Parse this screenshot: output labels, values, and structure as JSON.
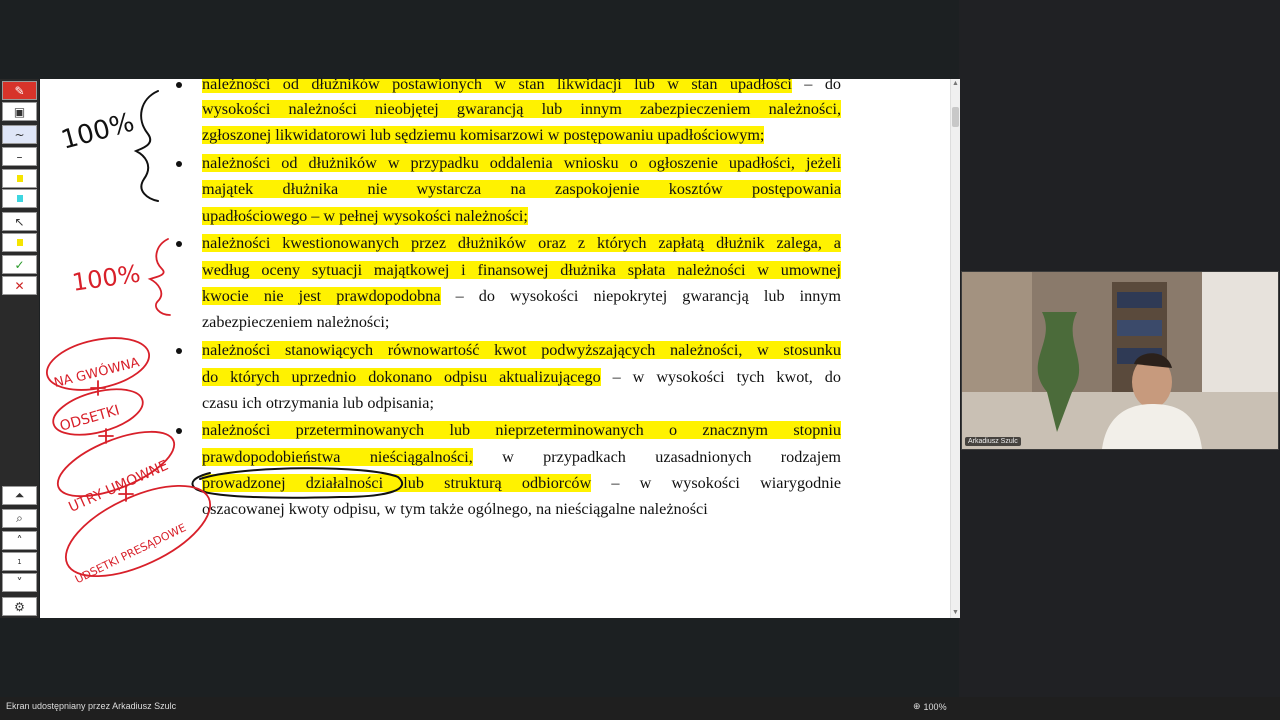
{
  "document": {
    "lines": [
      {
        "segs": [
          {
            "t": "należności od dłużników postawionych w stan likwidacji lub w stan upadłości",
            "h": true
          },
          {
            "t": " – do",
            "h": false
          }
        ],
        "bullet": true,
        "justify": true
      },
      {
        "segs": [
          {
            "t": "wysokości należności nieobjętej gwarancją lub innym zabezpieczeniem należności,",
            "h": true
          }
        ],
        "bullet": false,
        "justify": true
      },
      {
        "segs": [
          {
            "t": "zgłoszonej likwidatorowi lub sędziemu komisarzowi w postępowaniu upadłościowym;",
            "h": true
          }
        ],
        "bullet": false,
        "justify": false
      },
      {
        "segs": [
          {
            "t": "należności od dłużników w przypadku oddalenia wniosku o ogłoszenie upadłości, jeżeli",
            "h": true
          }
        ],
        "bullet": true,
        "justify": true
      },
      {
        "segs": [
          {
            "t": "majątek dłużnika nie wystarcza na zaspokojenie kosztów postępowania",
            "h": true
          }
        ],
        "bullet": false,
        "justify": true
      },
      {
        "segs": [
          {
            "t": "upadłościowego – w pełnej wysokości należności;",
            "h": true
          }
        ],
        "bullet": false,
        "justify": false
      },
      {
        "segs": [
          {
            "t": "należności kwestionowanych przez dłużników oraz z których zapłatą dłużnik zalega, a",
            "h": true
          }
        ],
        "bullet": true,
        "justify": true
      },
      {
        "segs": [
          {
            "t": "według oceny sytuacji majątkowej i finansowej dłużnika spłata należności w umownej",
            "h": true
          }
        ],
        "bullet": false,
        "justify": true
      },
      {
        "segs": [
          {
            "t": "kwocie nie jest prawdopodobna",
            "h": true
          },
          {
            "t": " – do wysokości niepokrytej gwarancją lub innym",
            "h": false
          }
        ],
        "bullet": false,
        "justify": true
      },
      {
        "segs": [
          {
            "t": "zabezpieczeniem należności;",
            "h": false
          }
        ],
        "bullet": false,
        "justify": false
      },
      {
        "segs": [
          {
            "t": "należności stanowiących równowartość kwot podwyższających należności, w stosunku",
            "h": true
          }
        ],
        "bullet": true,
        "justify": true
      },
      {
        "segs": [
          {
            "t": "do których uprzednio dokonano odpisu aktualizującego",
            "h": true
          },
          {
            "t": " – w wysokości tych kwot, do",
            "h": false
          }
        ],
        "bullet": false,
        "justify": true
      },
      {
        "segs": [
          {
            "t": "czasu ich otrzymania lub odpisania;",
            "h": false
          }
        ],
        "bullet": false,
        "justify": false
      },
      {
        "segs": [
          {
            "t": "należności przeterminowanych lub nieprzeterminowanych o znacznym stopniu",
            "h": true
          }
        ],
        "bullet": true,
        "justify": true
      },
      {
        "segs": [
          {
            "t": "prawdopodobieństwa nieściągalności,",
            "h": true
          },
          {
            "t": " w przypadkach uzasadnionych rodzajem",
            "h": false
          }
        ],
        "bullet": false,
        "justify": true
      },
      {
        "segs": [
          {
            "t": "prowadzonej działalności lub strukturą odbiorców",
            "h": true
          },
          {
            "t": " – w wysokości wiarygodnie",
            "h": false
          }
        ],
        "bullet": false,
        "justify": true
      },
      {
        "segs": [
          {
            "t": "oszacowanej kwoty odpisu, w tym także ogólnego, na nieściągalne należności",
            "h": false
          }
        ],
        "bullet": false,
        "justify": false
      }
    ]
  },
  "annotations": {
    "note1": "100%",
    "note2": "100%",
    "n3": "NA GWÓWNA",
    "n4": "ODSETKI",
    "n5": "UTRY UMOWNE",
    "n6": "UDSETKI PRESĄDOWE",
    "n7": "SĄDOWE"
  },
  "toolbar": {
    "tools": [
      "pen-icon",
      "save-icon",
      "curve-icon",
      "thin-line-icon",
      "yellow-highlighter-icon",
      "cyan-highlighter-icon",
      "pointer-icon",
      "highlight-pointer-icon",
      "check-icon",
      "close-icon"
    ],
    "page_number": "1"
  },
  "video": {
    "name": "Arkadiusz Szulc"
  },
  "status": {
    "sharing_text": "Ekran udostępniany przez Arkadiusz Szulc",
    "zoom": "100%"
  },
  "colors": {
    "highlight": "#fff200",
    "ink": "#d8202a",
    "toolbar_red": "#d7332a"
  }
}
